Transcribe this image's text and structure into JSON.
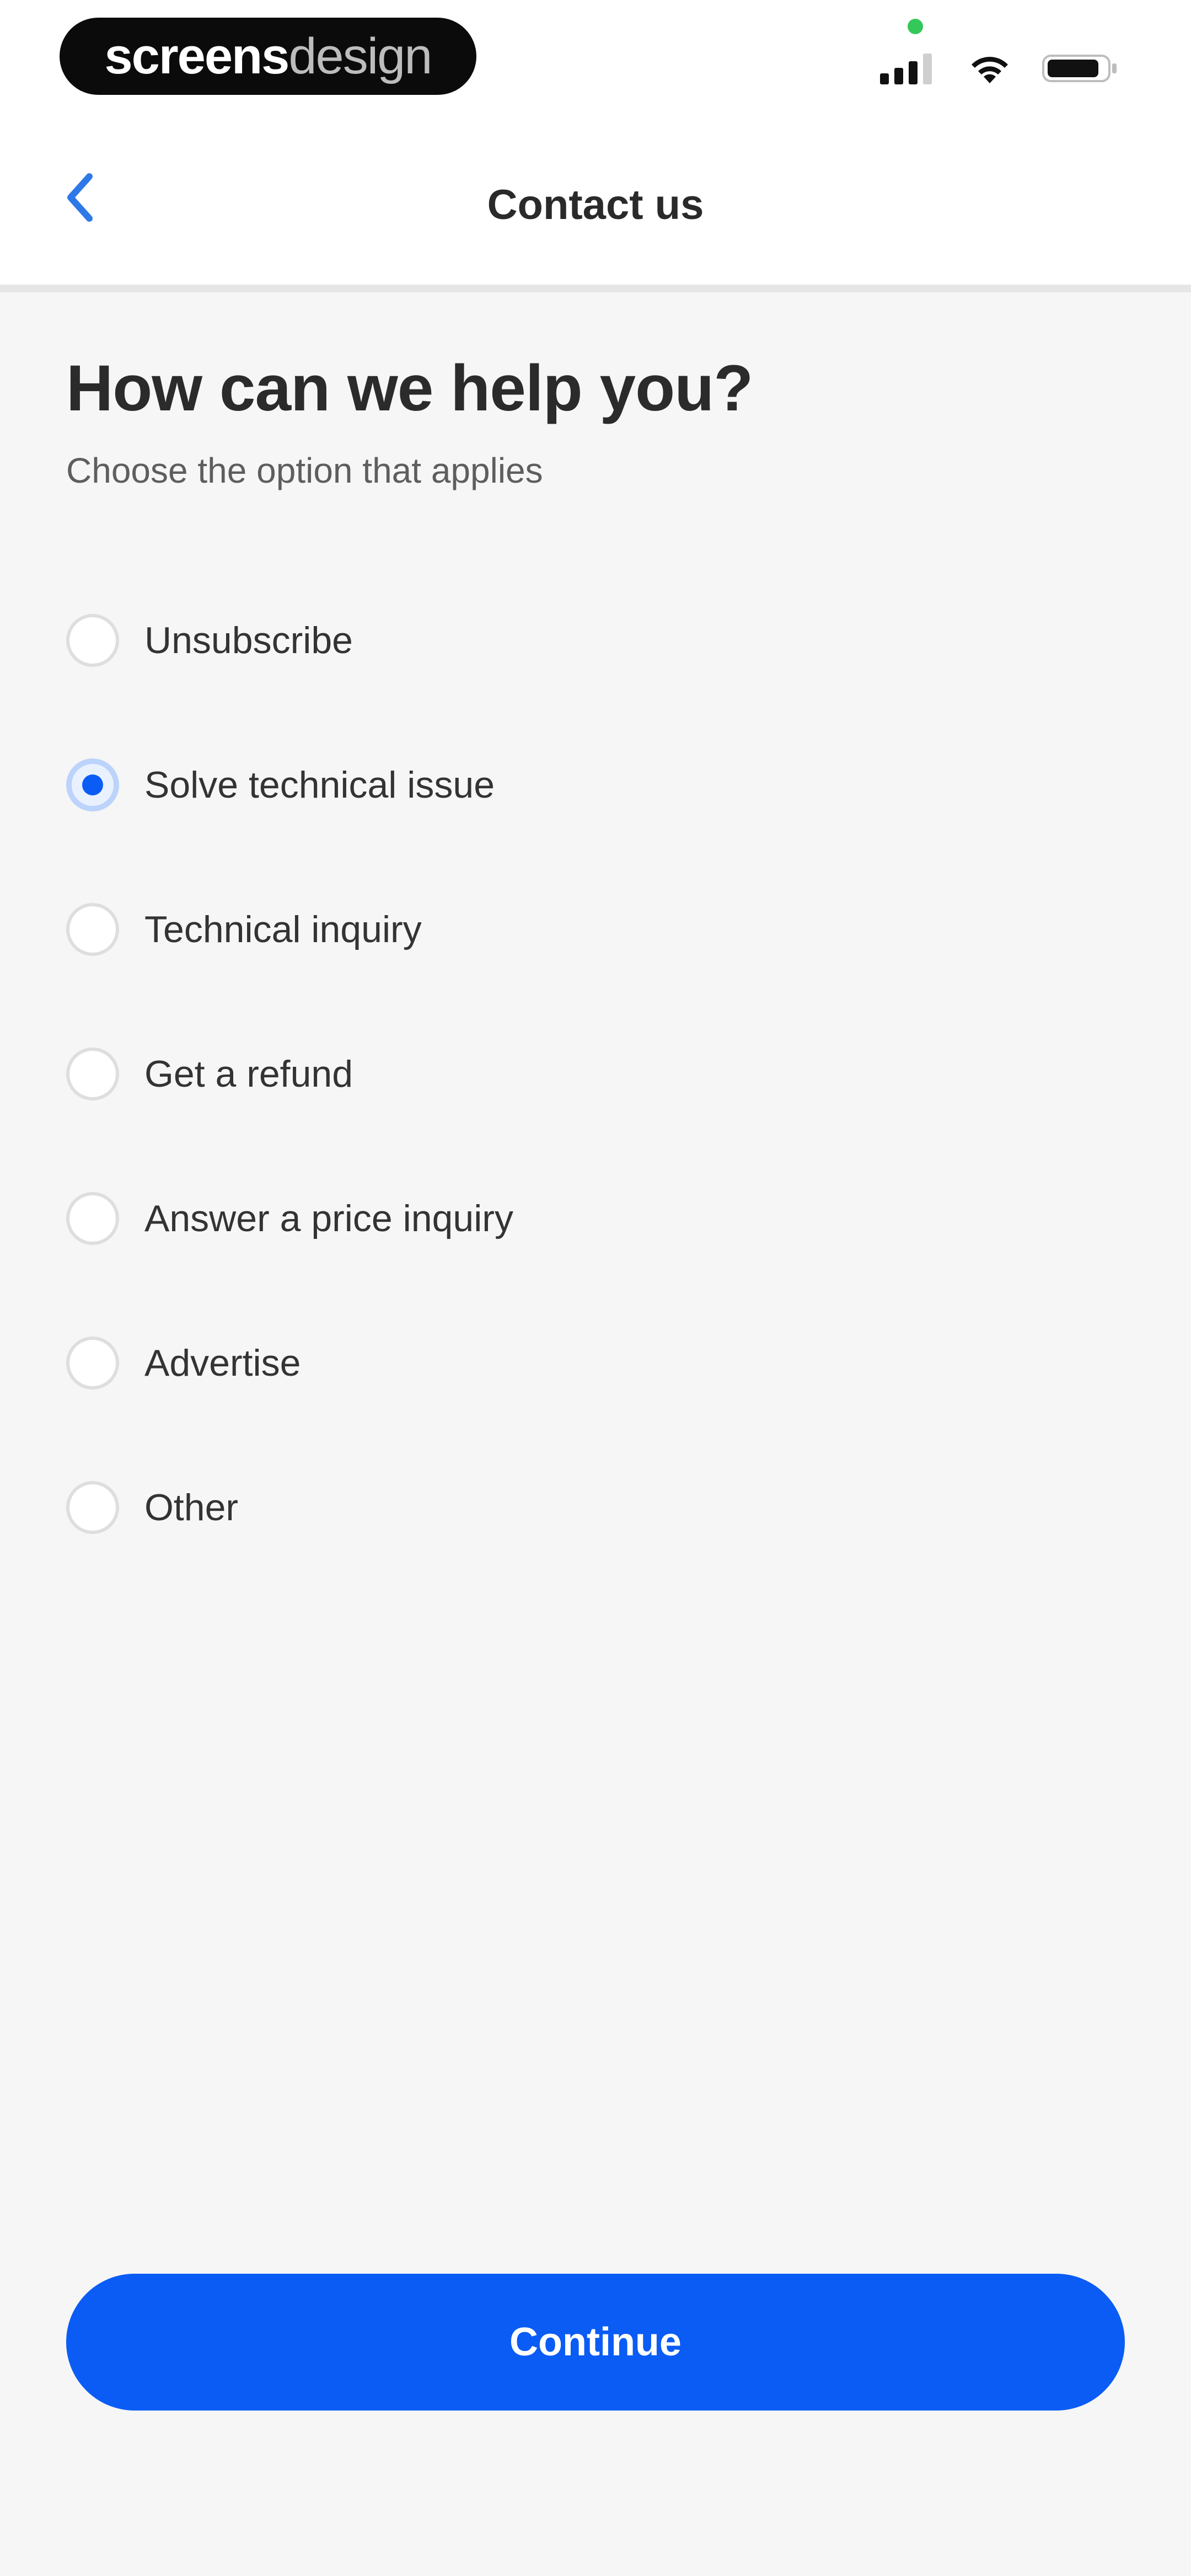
{
  "status_bar": {
    "brand_part_bold": "screens",
    "brand_part_light": "design",
    "icons": [
      "cellular-signal-icon",
      "wifi-icon",
      "battery-icon"
    ],
    "indicator_color": "#34c759"
  },
  "navbar": {
    "back_icon": "chevron-left-icon",
    "title": "Contact us"
  },
  "main": {
    "heading": "How can we help you?",
    "subheading": "Choose the option that applies",
    "options": [
      {
        "label": "Unsubscribe",
        "selected": false
      },
      {
        "label": "Solve technical issue",
        "selected": true
      },
      {
        "label": "Technical inquiry",
        "selected": false
      },
      {
        "label": "Get a refund",
        "selected": false
      },
      {
        "label": "Answer a price inquiry",
        "selected": false
      },
      {
        "label": "Advertise",
        "selected": false
      },
      {
        "label": "Other",
        "selected": false
      }
    ],
    "continue_label": "Continue"
  },
  "colors": {
    "accent": "#0a5cf5",
    "background": "#f6f6f6",
    "surface": "#ffffff"
  }
}
